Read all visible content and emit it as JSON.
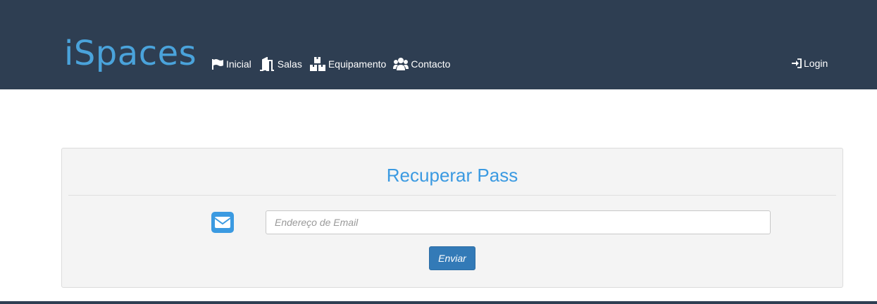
{
  "header": {
    "brand": "iSpaces",
    "nav": [
      {
        "label": "Inicial",
        "icon": "flag-icon"
      },
      {
        "label": "Salas",
        "icon": "door-icon"
      },
      {
        "label": "Equipamento",
        "icon": "boxes-icon"
      },
      {
        "label": "Contacto",
        "icon": "users-icon"
      }
    ],
    "login_label": "Login",
    "login_icon": "sign-in-icon"
  },
  "recover": {
    "title": "Recuperar Pass",
    "email_placeholder": "Endereço de Email",
    "email_value": "",
    "email_icon": "envelope-icon",
    "submit_label": "Enviar"
  },
  "colors": {
    "header_bg": "#2e3e52",
    "brand": "#4aa3db",
    "title": "#3b9ae1",
    "button": "#337ab7",
    "panel_bg": "#f4f4f4"
  }
}
